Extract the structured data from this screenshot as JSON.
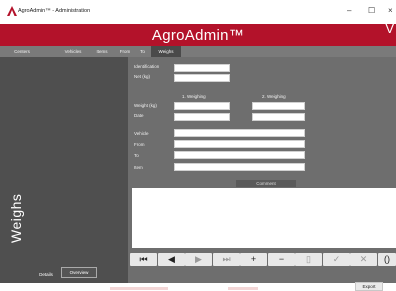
{
  "window": {
    "title": "AgroAdmin™ - Administration",
    "minimize": "–",
    "maximize": "☐",
    "close": "×"
  },
  "header": {
    "app_name": "AgroAdmin™",
    "edge_glyph": "V"
  },
  "tabs": [
    "Centers",
    "Vehicles",
    "Items",
    "From",
    "To",
    "Weighs"
  ],
  "active_tab": "Weighs",
  "sidebar": {
    "title": "Weighs",
    "tabs": [
      "Details",
      "Overview"
    ],
    "selected_tab": "Overview"
  },
  "form": {
    "identification_label": "Identification",
    "net_label": "Net (kg)",
    "weighing1_header": "1. Weighing",
    "weighing2_header": "2. Weighing",
    "weight_label": "Weight (kg)",
    "date_label": "Date",
    "vehicle_label": "Vehicle",
    "from_label": "From",
    "to_label": "To",
    "item_label": "Item",
    "comment_header": "Comment"
  },
  "nav_buttons": [
    {
      "name": "first-record-icon",
      "glyph": "⏮",
      "disabled": false
    },
    {
      "name": "previous-record-icon",
      "glyph": "◀",
      "disabled": false
    },
    {
      "name": "next-record-icon",
      "glyph": "▶",
      "disabled": true
    },
    {
      "name": "last-record-icon",
      "glyph": "⏭",
      "disabled": true
    },
    {
      "name": "add-record-icon",
      "glyph": "+",
      "disabled": false
    },
    {
      "name": "delete-record-icon",
      "glyph": "−",
      "disabled": false
    },
    {
      "name": "edit-record-icon",
      "glyph": "▯",
      "disabled": true
    },
    {
      "name": "confirm-icon",
      "glyph": "✓",
      "disabled": true
    },
    {
      "name": "cancel-icon",
      "glyph": "✕",
      "disabled": true
    },
    {
      "name": "refresh-icon",
      "glyph": "()",
      "disabled": false
    }
  ],
  "export_label": "Export",
  "colors": {
    "brand": "#b3122a",
    "panel": "#6e6e6e",
    "sidebar": "#4f4f4f",
    "tabbar": "#7a7a7a"
  }
}
